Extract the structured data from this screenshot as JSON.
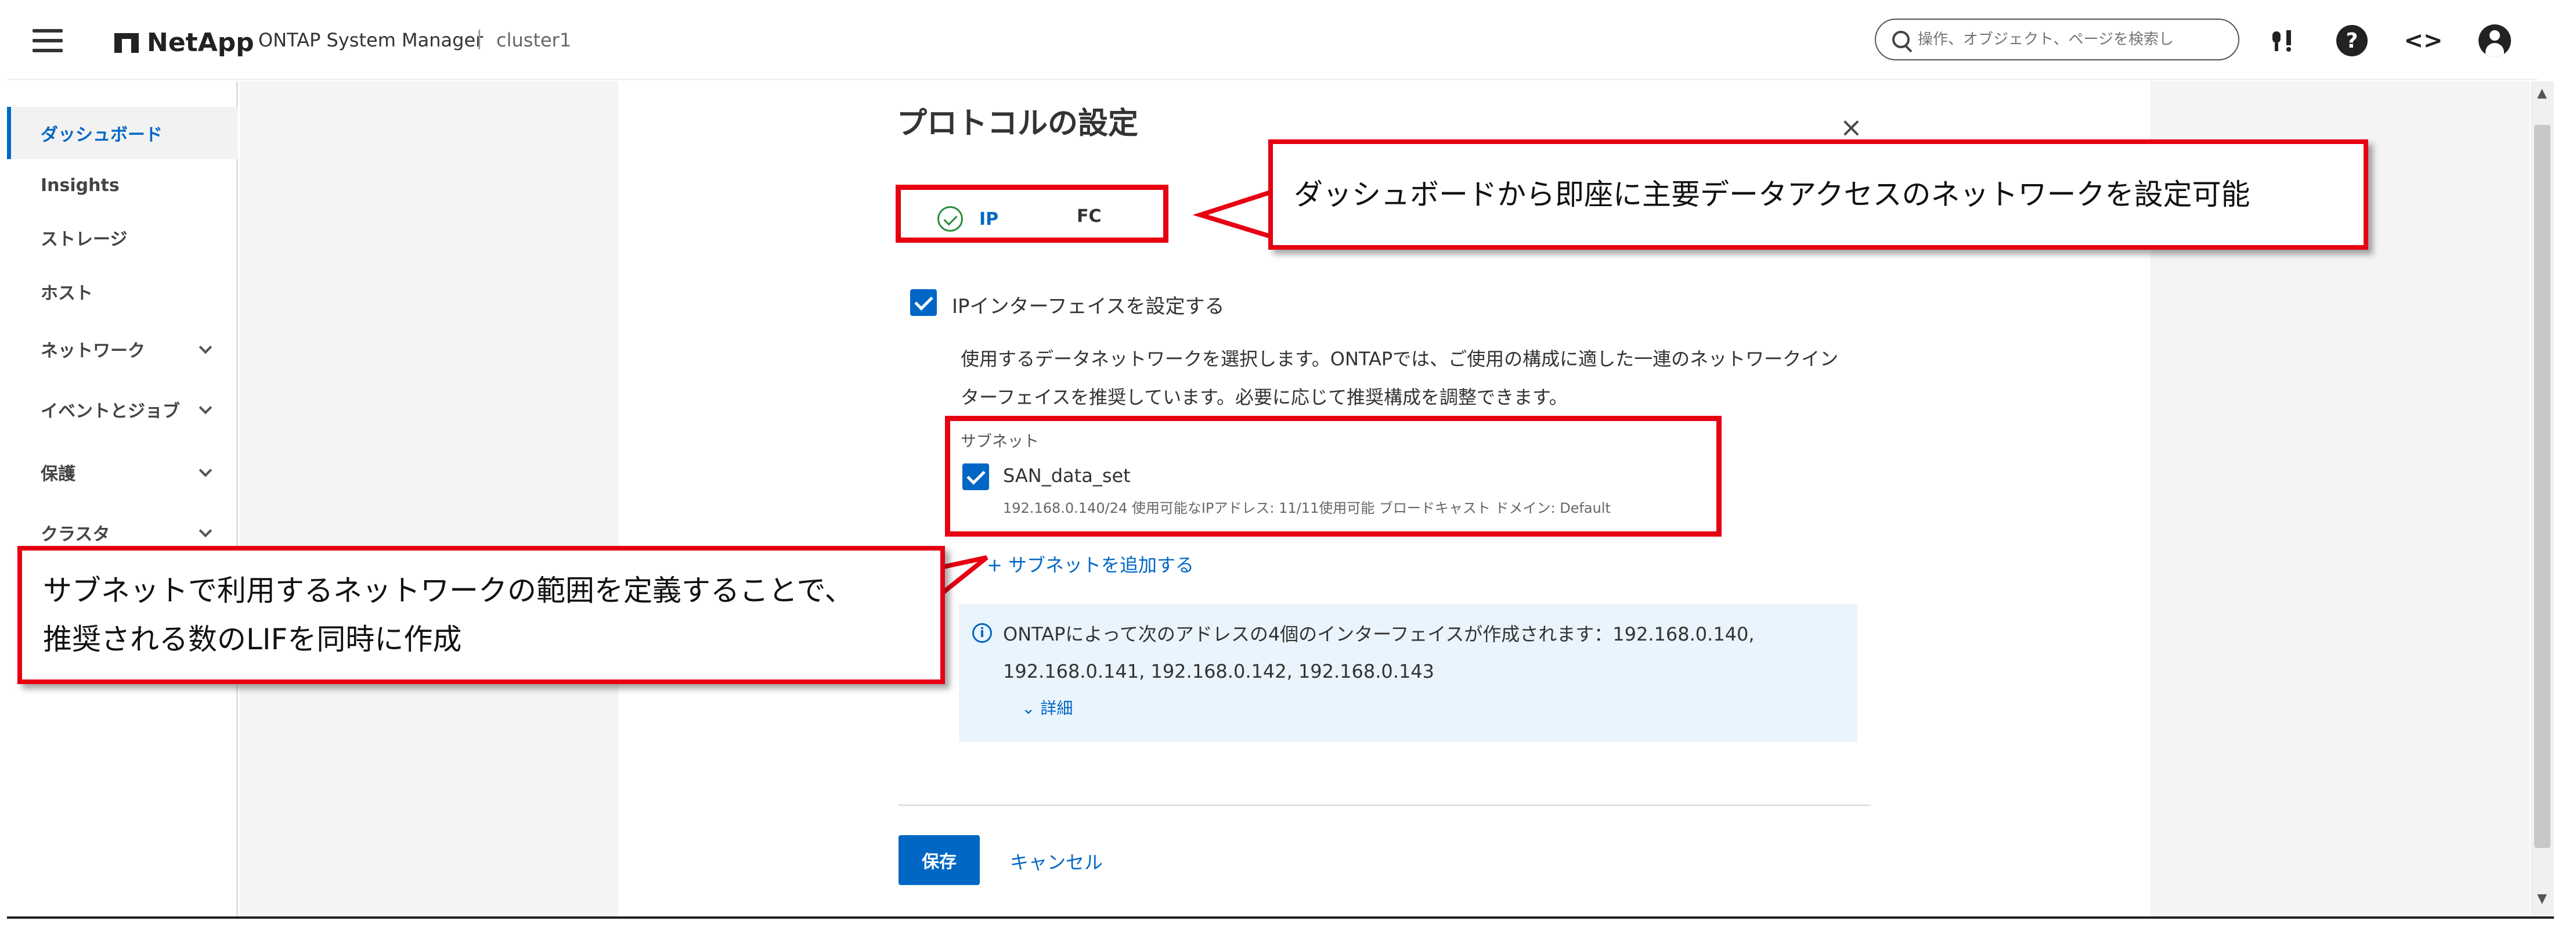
{
  "header": {
    "brand": "NetApp",
    "app_title": "ONTAP System Manager",
    "separator": "|",
    "cluster": "cluster1",
    "search_placeholder": "操作、オブジェクト、ページを検索し",
    "help_glyph": "?",
    "code_glyph": "<>"
  },
  "sidebar": {
    "items": [
      {
        "label": "ダッシュボード",
        "active": true
      },
      {
        "label": "Insights"
      },
      {
        "label": "ストレージ"
      },
      {
        "label": "ホスト"
      },
      {
        "label": "ネットワーク",
        "expandable": true
      },
      {
        "label": "イベントとジョブ",
        "expandable": true
      },
      {
        "label": "保護",
        "expandable": true
      },
      {
        "label": "クラスタ",
        "expandable": true
      }
    ]
  },
  "dialog": {
    "title": "プロトコルの設定",
    "close_glyph": "×",
    "tabs": [
      {
        "label": "IP",
        "completed": true
      },
      {
        "label": "FC"
      }
    ],
    "ip_interface_checkbox_label": "IPインターフェイスを設定する",
    "description": "使用するデータネットワークを選択します。ONTAPでは、ご使用の構成に適した一連のネットワークインターフェイスを推奨しています。必要に応じて推奨構成を調整できます。",
    "subnet_section_label": "サブネット",
    "subnet": {
      "name": "SAN_data_set",
      "meta": "192.168.0.140/24  使用可能なIPアドレス: 11/11使用可能  ブロードキャスト ドメイン: Default"
    },
    "add_subnet_label": "+ サブネットを追加する",
    "info_icon_glyph": "i",
    "info_text": "ONTAPによって次のアドレスの4個のインターフェイスが作成されます：192.168.0.140, 192.168.0.141, 192.168.0.142, 192.168.0.143",
    "details_label": "⌄  詳細",
    "save_label": "保存",
    "cancel_label": "キャンセル"
  },
  "callouts": {
    "top": "ダッシュボードから即座に主要データアクセスのネットワークを設定可能",
    "bottom_line1": "サブネットで利用するネットワークの範囲を定義することで、",
    "bottom_line2": "推奨される数のLIFを同時に作成"
  },
  "colors": {
    "accent": "#0067c5",
    "callout_red": "#e60012",
    "success_green": "#2a8c3b"
  }
}
